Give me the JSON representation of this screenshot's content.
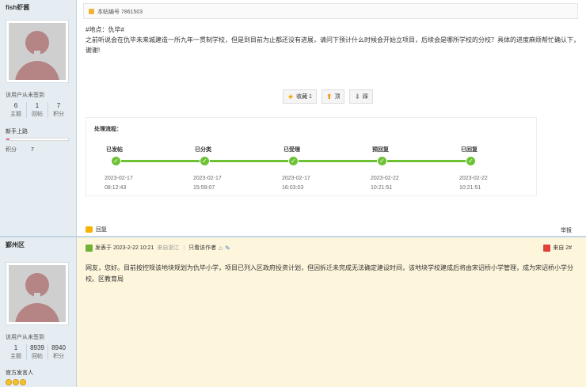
{
  "post1": {
    "author": {
      "name": "fish虾酱",
      "signin_text": "该用户从未签到",
      "stats": [
        {
          "value": "6",
          "label": "主题"
        },
        {
          "value": "1",
          "label": "回帖"
        },
        {
          "value": "7",
          "label": "积分"
        }
      ],
      "rank": "新手上路",
      "rank_progress": 0.05,
      "score_label": "积分",
      "score_value": "7"
    },
    "post_number": "本帖编号 7861503",
    "location_tag": "#地点：仇毕#",
    "body": "之前听说会在仇毕未来城建造一所九年一贯制学校，但是到目前为止都还没有进展，请问下预计什么时候会开始立项目，后续会是哪所学校的分校？具体的进度麻烦帮忙确认下，谢谢!",
    "buttons": {
      "favorite": "收藏 1",
      "top": "顶",
      "down": "踩"
    },
    "flow": {
      "title": "处理流程：",
      "steps": [
        {
          "name": "已发帖",
          "date": "2023-02-17",
          "time": "08:12:43"
        },
        {
          "name": "已分类",
          "date": "2023-02-17",
          "time": "15:59:07"
        },
        {
          "name": "已受理",
          "date": "2023-02-17",
          "time": "16:03:03"
        },
        {
          "name": "预回复",
          "date": "2023-02-22",
          "time": "10:21:51"
        },
        {
          "name": "已回复",
          "date": "2023-02-22",
          "time": "10:21:51"
        }
      ]
    },
    "reply_label": "回复",
    "report_label": "举报"
  },
  "post2": {
    "author": {
      "name": "鄞州区",
      "signin_text": "该用户从未签到",
      "stats": [
        {
          "value": "1",
          "label": "主题"
        },
        {
          "value": "8939",
          "label": "回帖"
        },
        {
          "value": "8940",
          "label": "积分"
        }
      ],
      "role": "官方发言人"
    },
    "meta": {
      "posted": "发表于 2023-2-22 10:21",
      "from": "来自浙江",
      "only_author": "只看该作者"
    },
    "floor": "来自 2#",
    "body": "网友，您好。目前按控规该地块规划为仇毕小学，项目已列入区政府投资计划，但因拆迁未完成无法确定建设时间，该地块学校建成后将由宋诏桥小学管理，成为宋诏桥小学分校。区教育局"
  }
}
